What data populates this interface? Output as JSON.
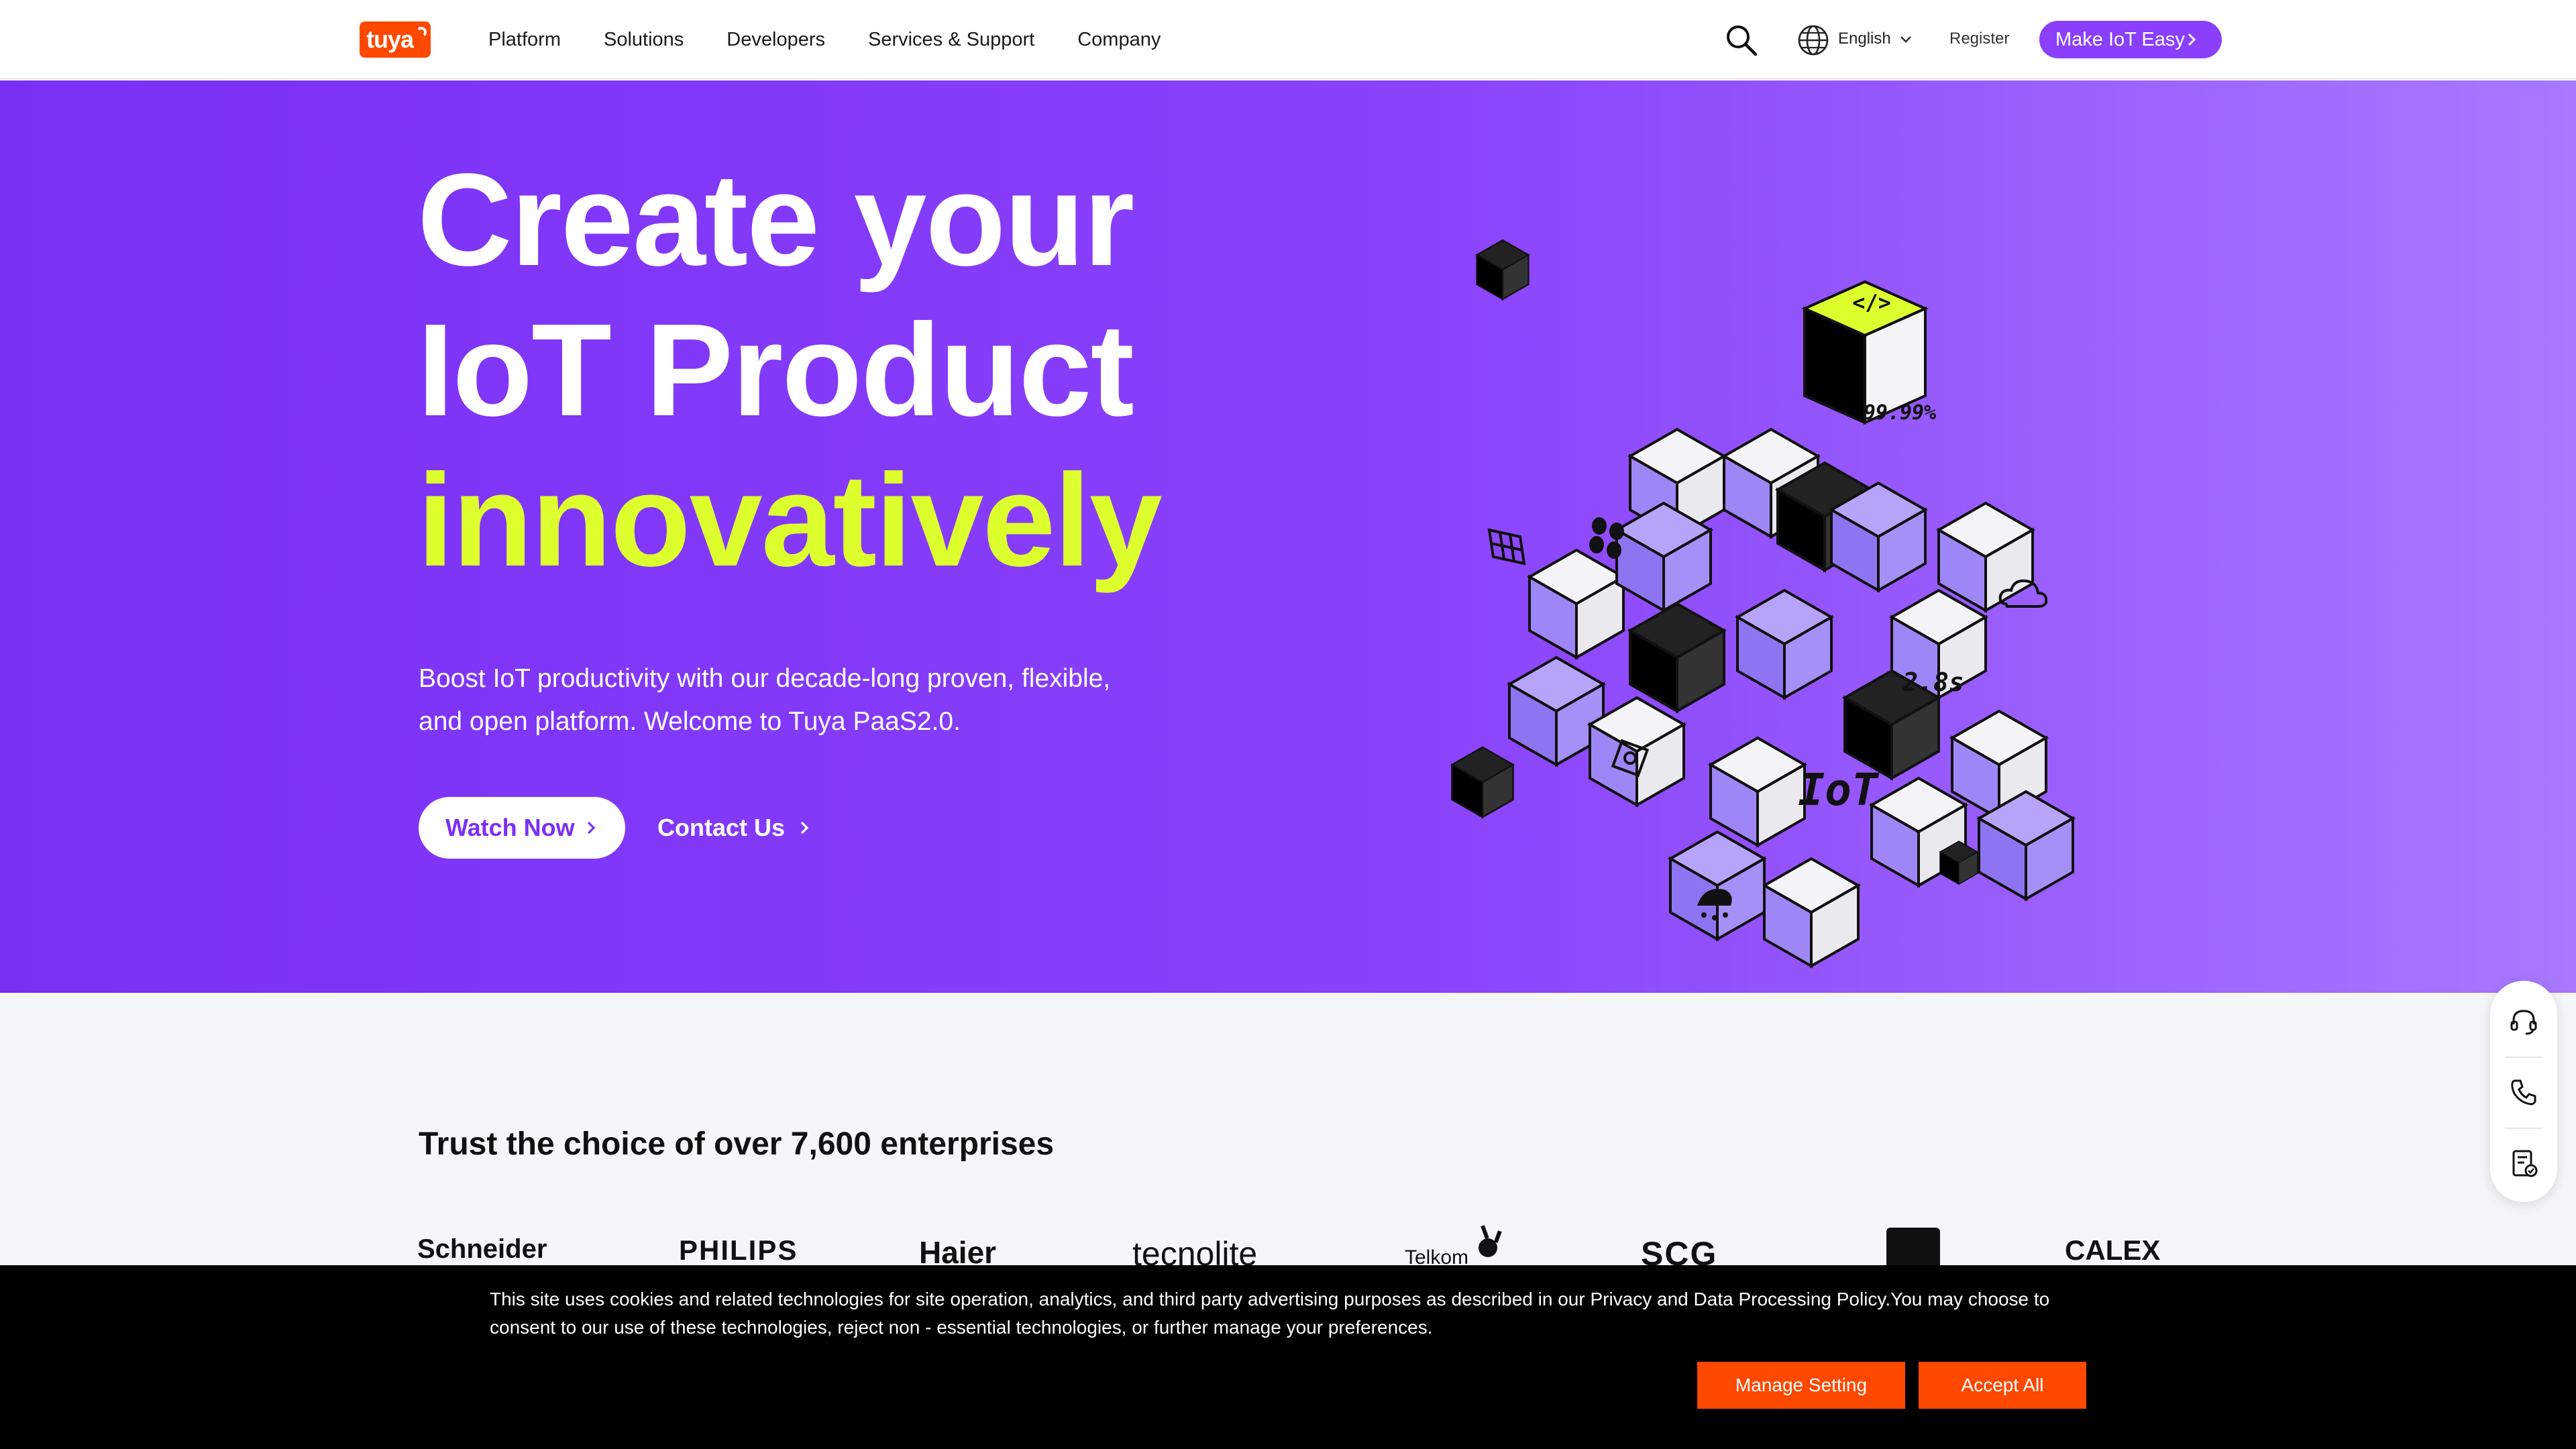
{
  "header": {
    "logo_text": "tuya",
    "nav": [
      "Platform",
      "Solutions",
      "Developers",
      "Services & Support",
      "Company"
    ],
    "language": "English",
    "register": "Register",
    "cta": "Make IoT Easy"
  },
  "hero": {
    "title_line1": "Create your",
    "title_line2": "IoT Product",
    "title_accent": "innovatively",
    "subtitle": "Boost IoT productivity with our decade-long proven, flexible, and open platform. Welcome to Tuya PaaS2.0.",
    "watch_button": "Watch Now",
    "contact_button": "Contact Us",
    "art": {
      "uptime": "99.99%",
      "speed": "2.8s",
      "iot": "IoT",
      "code": "</>"
    }
  },
  "sidebar": {
    "icons": [
      "headset-icon",
      "phone-icon",
      "document-icon"
    ]
  },
  "trust": {
    "title": "Trust the choice of over 7,600 enterprises",
    "brands": [
      "Schneider",
      "PHILIPS",
      "Haier",
      "tecnolite",
      "Telkom",
      "SCG",
      "",
      "CALEX"
    ]
  },
  "cookie": {
    "text": "This site uses cookies and related technologies for site operation, analytics, and third party advertising purposes as described in our Privacy and Data Processing Policy.You may choose to consent to our use of these technologies, reject non - essential technologies, or further manage your preferences.",
    "manage": "Manage Setting",
    "accept": "Accept All"
  },
  "colors": {
    "brand_purple": "#8a3ffc",
    "hero_start": "#7a2ff5",
    "accent_lime": "#ddff2e",
    "tuya_orange": "#ff4800",
    "cube_lilac": "#9f86f6"
  }
}
